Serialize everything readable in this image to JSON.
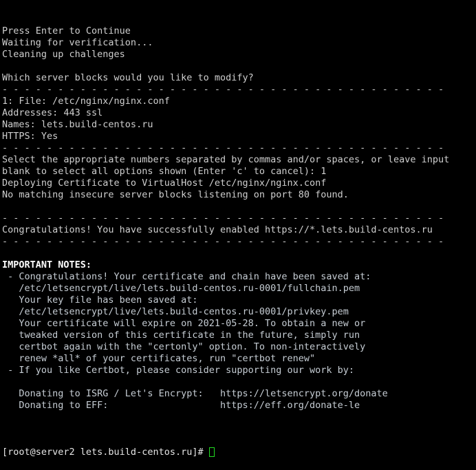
{
  "terminal": {
    "title": "certbot nginx terminal session",
    "colors": {
      "background": "#000000",
      "foreground": "#cfcfcf",
      "note_text": "#c6cdd4",
      "bold_heading": "#ffffff",
      "cursor_outline": "#22dd22"
    },
    "separator": "- - - - - - - - - - - - - - - - - - - - - - - - - - - - - - - - - - - - - - - -",
    "lines": [
      {
        "kind": "text",
        "text": "Press Enter to Continue"
      },
      {
        "kind": "text",
        "text": "Waiting for verification..."
      },
      {
        "kind": "text",
        "text": "Cleaning up challenges"
      },
      {
        "kind": "blank",
        "text": ""
      },
      {
        "kind": "text",
        "text": "Which server blocks would you like to modify?"
      },
      {
        "kind": "sep",
        "text": "- - - - - - - - - - - - - - - - - - - - - - - - - - - - - - - - - - - - - - - -"
      },
      {
        "kind": "text",
        "text": "1: File: /etc/nginx/nginx.conf"
      },
      {
        "kind": "text",
        "text": "Addresses: 443 ssl"
      },
      {
        "kind": "text",
        "text": "Names: lets.build-centos.ru"
      },
      {
        "kind": "text",
        "text": "HTTPS: Yes"
      },
      {
        "kind": "sep",
        "text": "- - - - - - - - - - - - - - - - - - - - - - - - - - - - - - - - - - - - - - - -"
      },
      {
        "kind": "text",
        "text": "Select the appropriate numbers separated by commas and/or spaces, or leave input"
      },
      {
        "kind": "text",
        "text": "blank to select all options shown (Enter 'c' to cancel): 1"
      },
      {
        "kind": "text",
        "text": "Deploying Certificate to VirtualHost /etc/nginx/nginx.conf"
      },
      {
        "kind": "text",
        "text": "No matching insecure server blocks listening on port 80 found."
      },
      {
        "kind": "blank",
        "text": ""
      },
      {
        "kind": "sep",
        "text": "- - - - - - - - - - - - - - - - - - - - - - - - - - - - - - - - - - - - - - - -"
      },
      {
        "kind": "text",
        "text": "Congratulations! You have successfully enabled https://*.lets.build-centos.ru"
      },
      {
        "kind": "sep",
        "text": "- - - - - - - - - - - - - - - - - - - - - - - - - - - - - - - - - - - - - - - -"
      },
      {
        "kind": "blank",
        "text": ""
      },
      {
        "kind": "bold",
        "text": "IMPORTANT NOTES:"
      },
      {
        "kind": "note",
        "text": " - Congratulations! Your certificate and chain have been saved at:"
      },
      {
        "kind": "note",
        "text": "   /etc/letsencrypt/live/lets.build-centos.ru-0001/fullchain.pem"
      },
      {
        "kind": "note",
        "text": "   Your key file has been saved at:"
      },
      {
        "kind": "note",
        "text": "   /etc/letsencrypt/live/lets.build-centos.ru-0001/privkey.pem"
      },
      {
        "kind": "note",
        "text": "   Your certificate will expire on 2021-05-28. To obtain a new or"
      },
      {
        "kind": "note",
        "text": "   tweaked version of this certificate in the future, simply run"
      },
      {
        "kind": "note",
        "text": "   certbot again with the \"certonly\" option. To non-interactively"
      },
      {
        "kind": "note",
        "text": "   renew *all* of your certificates, run \"certbot renew\""
      },
      {
        "kind": "note",
        "text": " - If you like Certbot, please consider supporting our work by:"
      },
      {
        "kind": "blank",
        "text": ""
      },
      {
        "kind": "note",
        "text": "   Donating to ISRG / Let's Encrypt:   https://letsencrypt.org/donate"
      },
      {
        "kind": "note",
        "text": "   Donating to EFF:                    https://eff.org/donate-le"
      },
      {
        "kind": "blank",
        "text": ""
      }
    ],
    "prompt": {
      "text": "[root@server2 lets.build-centos.ru]# ",
      "user": "root",
      "host": "server2",
      "cwd": "lets.build-centos.ru",
      "symbol": "#",
      "cursor": "block-outline-cursor"
    }
  }
}
